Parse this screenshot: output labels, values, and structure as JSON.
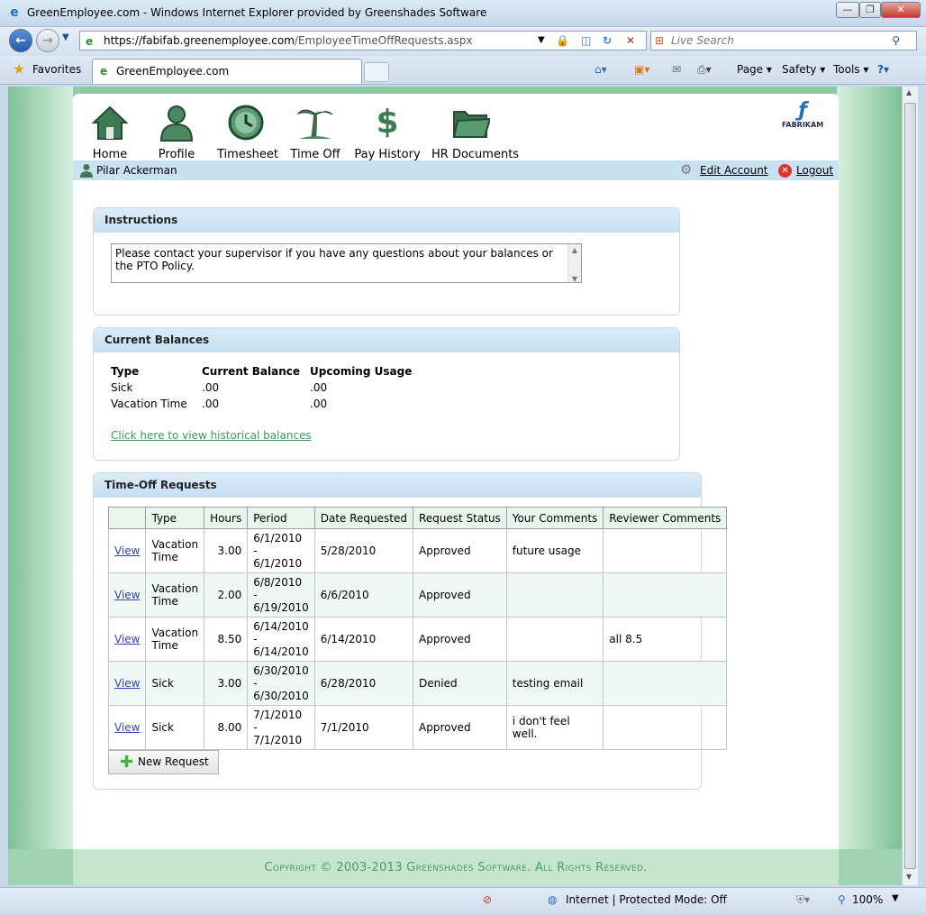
{
  "window": {
    "title": "GreenEmployee.com - Windows Internet Explorer provided by Greenshades Software",
    "minimize": "—",
    "restore": "❐",
    "close": "✕"
  },
  "address": {
    "url_prefix": "https://fabifab.",
    "url_domain": "greenemployee.com",
    "url_path": "/EmployeeTimeOffRequests.aspx",
    "search_placeholder": "Live Search"
  },
  "tabs": {
    "favorites": "Favorites",
    "active_tab": "GreenEmployee.com"
  },
  "commandbar": {
    "page": "Page",
    "safety": "Safety",
    "tools": "Tools"
  },
  "nav": {
    "items": [
      "Home",
      "Profile",
      "Timesheet",
      "Time Off",
      "Pay History",
      "HR Documents"
    ]
  },
  "logo": {
    "name": "FABRIKAM"
  },
  "userbar": {
    "user": "Pilar Ackerman",
    "edit_account": "Edit Account",
    "logout": "Logout"
  },
  "instructions": {
    "title": "Instructions",
    "text": "Please contact your supervisor if you have any questions about your balances or the PTO Policy."
  },
  "balances": {
    "title": "Current Balances",
    "headers": [
      "Type",
      "Current Balance",
      "Upcoming Usage"
    ],
    "rows": [
      [
        "Sick",
        ".00",
        ".00"
      ],
      [
        "Vacation Time",
        ".00",
        ".00"
      ]
    ],
    "history_link": "Click here to view historical balances"
  },
  "requests": {
    "title": "Time-Off Requests",
    "headers": [
      "",
      "Type",
      "Hours",
      "Period",
      "Date Requested",
      "Request Status",
      "Your Comments",
      "Reviewer Comments"
    ],
    "rows": [
      {
        "action": "View",
        "type": "Vacation Time",
        "hours": "3.00",
        "start": "6/1/2010",
        "sep": "-",
        "end": "6/1/2010",
        "requested": "5/28/2010",
        "status": "Approved",
        "comment": "future usage",
        "reviewer": ""
      },
      {
        "action": "View",
        "type": "Vacation Time",
        "hours": "2.00",
        "start": "6/8/2010",
        "sep": "-",
        "end": "6/19/2010",
        "requested": "6/6/2010",
        "status": "Approved",
        "comment": "",
        "reviewer": ""
      },
      {
        "action": "View",
        "type": "Vacation Time",
        "hours": "8.50",
        "start": "6/14/2010",
        "sep": "-",
        "end": "6/14/2010",
        "requested": "6/14/2010",
        "status": "Approved",
        "comment": "",
        "reviewer": "all 8.5"
      },
      {
        "action": "View",
        "type": "Sick",
        "hours": "3.00",
        "start": "6/30/2010",
        "sep": "-",
        "end": "6/30/2010",
        "requested": "6/28/2010",
        "status": "Denied",
        "comment": "testing email",
        "reviewer": ""
      },
      {
        "action": "View",
        "type": "Sick",
        "hours": "8.00",
        "start": "7/1/2010",
        "sep": "-",
        "end": "7/1/2010",
        "requested": "7/1/2010",
        "status": "Approved",
        "comment": "i don't feel well.",
        "reviewer": ""
      }
    ],
    "new_request": "New Request"
  },
  "footer": {
    "text": "Copyright © 2003-2013 Greenshades Software. All Rights Reserved."
  },
  "statusbar": {
    "zone": "Internet | Protected Mode: Off",
    "zoom": "100%"
  }
}
